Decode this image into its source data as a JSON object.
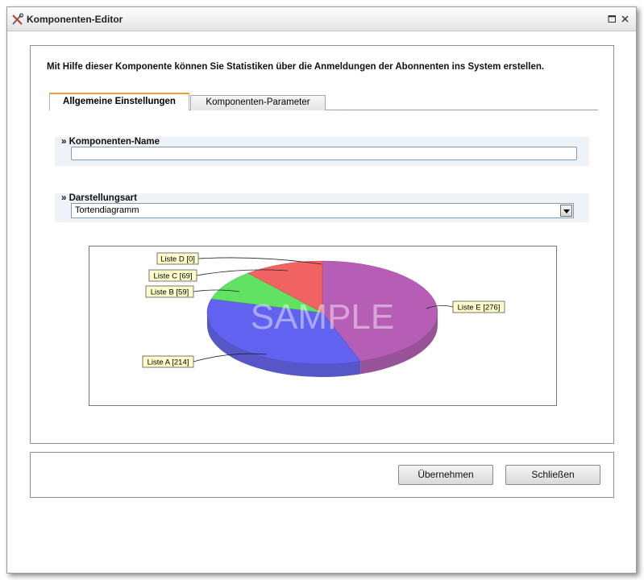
{
  "window": {
    "title": "Komponenten-Editor"
  },
  "description": "Mit Hilfe dieser Komponente können Sie Statistiken über die Anmeldungen der Abonnenten ins System erstellen.",
  "tabs": [
    {
      "label": "Allgemeine Einstellungen",
      "active": true
    },
    {
      "label": "Komponenten-Parameter",
      "active": false
    }
  ],
  "fields": {
    "name": {
      "label": "» Komponenten-Name",
      "value": ""
    },
    "display": {
      "label": "» Darstellungsart",
      "value": "Tortendiagramm"
    }
  },
  "chart_data": {
    "type": "pie",
    "watermark": "SAMPLE",
    "categories": [
      "Liste A",
      "Liste B",
      "Liste C",
      "Liste D",
      "Liste E"
    ],
    "values": [
      214,
      59,
      69,
      0,
      276
    ],
    "labels": [
      "Liste A [214]",
      "Liste B [59]",
      "Liste C [69]",
      "Liste D [0]",
      "Liste E [276]"
    ],
    "colors": [
      "#5555f0",
      "#55e055",
      "#f05555",
      "#f0a0a0",
      "#b050b0"
    ]
  },
  "buttons": {
    "apply": "Übernehmen",
    "close": "Schließen"
  }
}
